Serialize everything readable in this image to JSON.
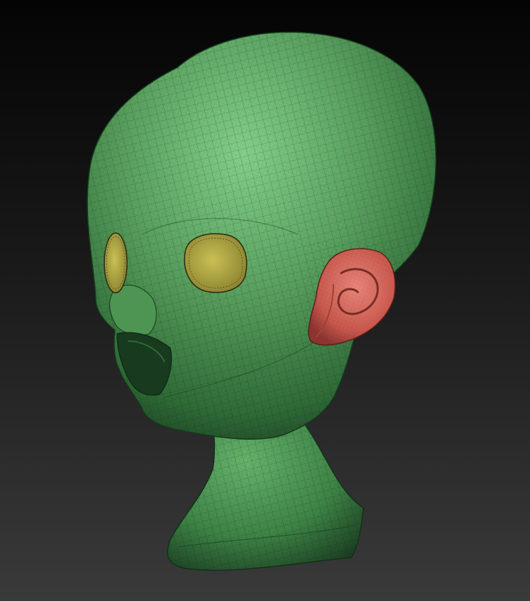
{
  "scene": {
    "subject": "head-sculpt",
    "background": {
      "top_color": "#040404",
      "bottom_color": "#3a3a3a"
    },
    "polygroups": {
      "skin": "#5aa15f",
      "skin_highlight": "#79c882",
      "skin_shadow": "#1f4a26",
      "eye_socket": "#b4aa45",
      "ear": "#d76a5e",
      "wire": "#10240f"
    }
  }
}
